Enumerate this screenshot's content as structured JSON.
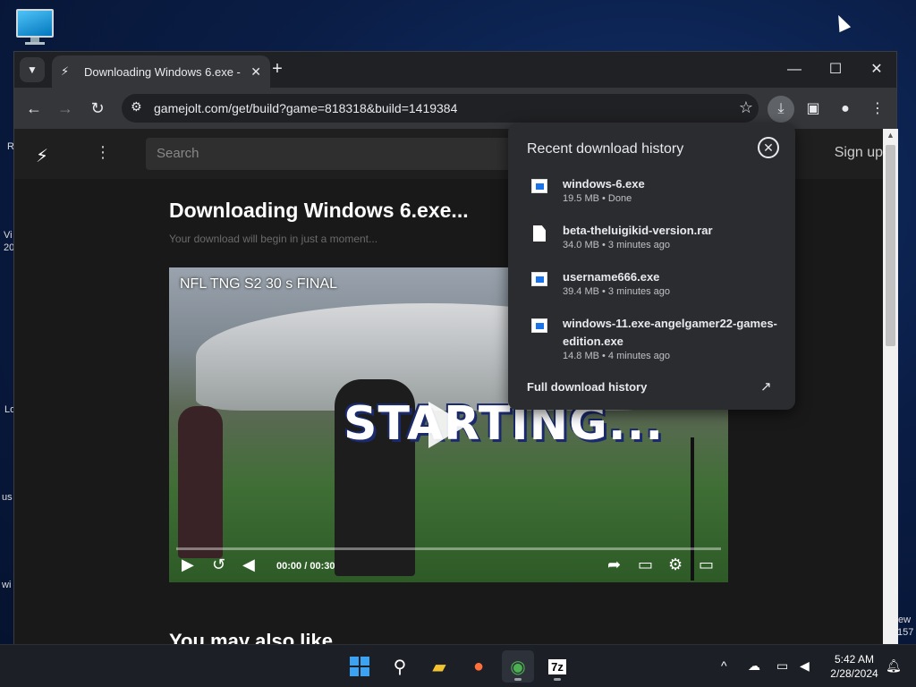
{
  "desktop": {
    "edge_labels": [
      "R",
      "Vi",
      "20",
      "Lo",
      "us",
      "wi",
      "ew",
      "157"
    ]
  },
  "browser": {
    "tab": {
      "title": "Downloading Windows 6.exe -",
      "close": "✕"
    },
    "new_tab": "+",
    "window_controls": {
      "minimize": "—",
      "maximize": "☐",
      "close": "✕"
    },
    "nav": {
      "back": "←",
      "forward": "→",
      "reload": "↻"
    },
    "url": "gamejolt.com/get/build?game=818318&build=1419384"
  },
  "site": {
    "search_placeholder": "Search",
    "sign_up": "Sign up",
    "heading": "Downloading Windows 6.exe...",
    "subheading": "Your download will begin in just a moment...",
    "video": {
      "title": "NFL TNG S2 30 s FINAL",
      "overlay_text": "STARTING...",
      "time_current": "00:00",
      "time_separator": "/",
      "time_total": "00:30",
      "progress": 0
    },
    "also_like": "You may also like"
  },
  "downloads": {
    "title": "Recent download history",
    "items": [
      {
        "name": "windows-6.exe",
        "meta": "19.5 MB • Done",
        "type": "exe"
      },
      {
        "name": "beta-theluigikid-version.rar",
        "meta": "34.0 MB • 3 minutes ago",
        "type": "doc"
      },
      {
        "name": "username666.exe",
        "meta": "39.4 MB • 3 minutes ago",
        "type": "exe"
      },
      {
        "name": "windows-11.exe-angelgamer22-games-edition.exe",
        "meta": "14.8 MB • 4 minutes ago",
        "type": "exe"
      }
    ],
    "full_history": "Full download history"
  },
  "taskbar": {
    "time": "5:42 AM",
    "date": "2/28/2024",
    "sevenzip_label": "7z"
  },
  "colors": {
    "accent": "#1a73e8",
    "page_bg": "#191919",
    "popup_bg": "#2b2c2f"
  }
}
